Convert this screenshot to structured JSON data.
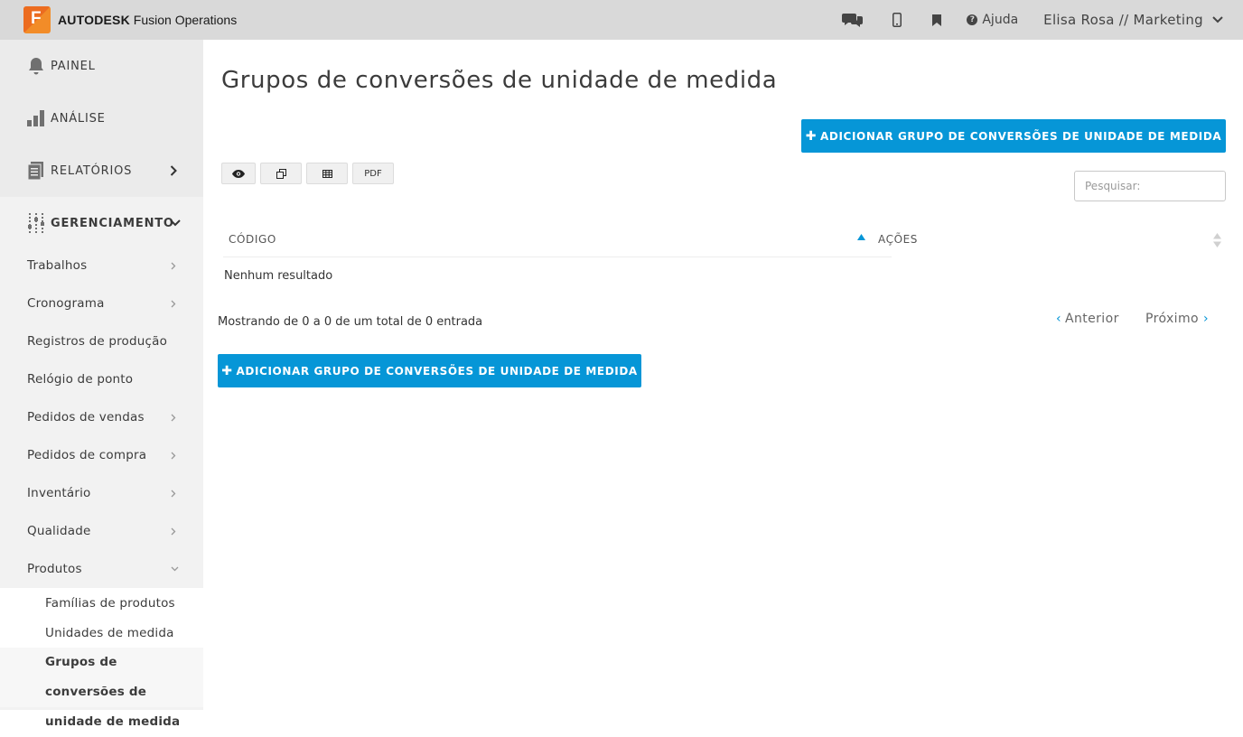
{
  "app": {
    "logo_letter": "F",
    "brand_strong": "AUTODESK",
    "brand_rest": "Fusion Operations",
    "accent_color": "#0696d7",
    "logo_color": "#f28c28"
  },
  "topbar": {
    "icons": [
      "chat-icon",
      "mobile-icon",
      "bookmark-icon",
      "help-icon"
    ],
    "help_label": "Ajuda",
    "user_label": "Elisa Rosa // Marketing"
  },
  "sidebar": {
    "main": [
      {
        "label": "PAINEL",
        "icon": "bell-icon"
      },
      {
        "label": "ANÁLISE",
        "icon": "bar-chart-icon"
      },
      {
        "label": "RELATÓRIOS",
        "icon": "reports-icon"
      },
      {
        "label": "GERENCIAMENTO",
        "icon": "sliders-icon"
      }
    ],
    "sub": [
      {
        "label": "Trabalhos"
      },
      {
        "label": "Cronograma"
      },
      {
        "label": "Registros de produção"
      },
      {
        "label": "Relógio de ponto"
      },
      {
        "label": "Pedidos de vendas"
      },
      {
        "label": "Pedidos de compra"
      },
      {
        "label": "Inventário"
      },
      {
        "label": "Qualidade"
      },
      {
        "label": "Produtos"
      }
    ],
    "children": [
      {
        "label": "Famílias de produtos"
      },
      {
        "label": "Unidades de medida"
      },
      {
        "label": "Grupos de conversões de unidade de medida"
      }
    ]
  },
  "main": {
    "title": "Grupos de conversões de unidade de medida",
    "add_button_label": "ADICIONAR GRUPO DE CONVERSÕES DE UNIDADE DE MEDIDA",
    "toolbar": {
      "pdf_label": "PDF"
    },
    "search_placeholder": "Pesquisar:",
    "table": {
      "columns": [
        "CÓDIGO",
        "AÇÕES"
      ],
      "empty_message": "Nenhum resultado"
    },
    "info_text": "Mostrando de 0 a 0 de um total de 0 entrada",
    "pager": {
      "prev": "Anterior",
      "next": "Próximo"
    }
  }
}
